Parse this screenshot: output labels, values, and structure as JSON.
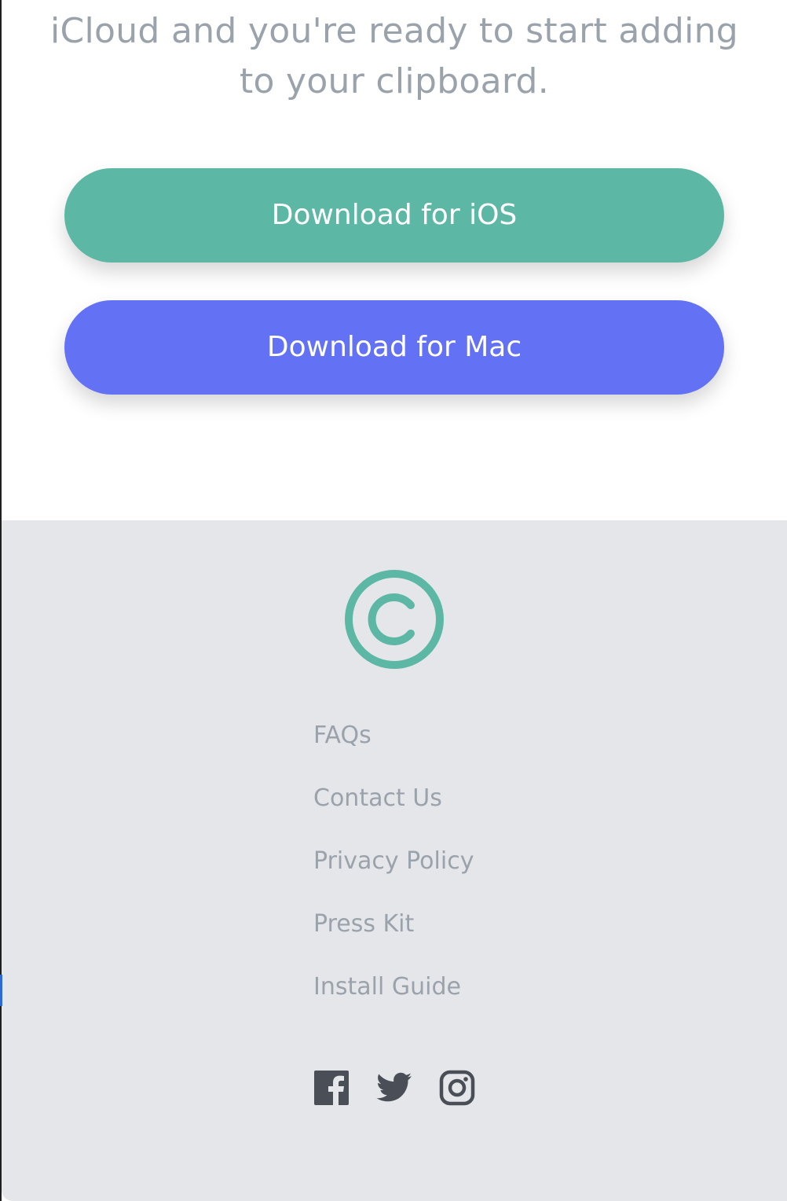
{
  "hero": {
    "text_line_1": "iCloud and you're ready to start adding",
    "text_line_2": "to your clipboard.",
    "ios_button_label": "Download for iOS",
    "mac_button_label": "Download for Mac"
  },
  "footer": {
    "links": [
      "FAQs",
      "Contact Us",
      "Privacy Policy",
      "Press Kit",
      "Install Guide"
    ],
    "social_icons": [
      "facebook-icon",
      "twitter-icon",
      "instagram-icon"
    ]
  },
  "colors": {
    "ios_button": "#5cb8a5",
    "mac_button": "#6371f4",
    "footer_background": "#e5e6e9",
    "muted_text": "#9aa2ab",
    "icon": "#4a4f57"
  }
}
